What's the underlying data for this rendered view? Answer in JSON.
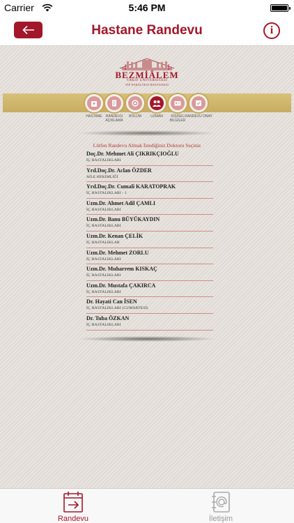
{
  "status_bar": {
    "carrier": "Carrier",
    "time": "5:46 PM"
  },
  "nav": {
    "title": "Hastane Randevu",
    "info_label": "i"
  },
  "logo": {
    "name": "BEZMİÂLEM",
    "subtitle": "VAKIF ÜNİVERSİTESİ",
    "subtitle2": "TIP FAKÜLTESİ HASTANESİ"
  },
  "steps": [
    {
      "label": "HASTANE",
      "active": false
    },
    {
      "label": "RANDEVU AÇIKLAMA",
      "active": false
    },
    {
      "label": "BÖLÜM",
      "active": false
    },
    {
      "label": "UZMAN",
      "active": true
    },
    {
      "label": "KİŞİSEL BİLGİLER",
      "active": false
    },
    {
      "label": "RANDEVU ONAY",
      "active": false
    }
  ],
  "prompt": "Lütfen Randevu Almak İstediğiniz Doktoru Seçiniz",
  "doctors": [
    {
      "name": "Doç.Dr. Mehmet Ali ÇIKRIKÇIOĞLU",
      "department": "İÇ HASTALIKLARI"
    },
    {
      "name": "Yrd.Doç.Dr. Aclan ÖZDER",
      "department": "AİLE HEKİMLİĞİ"
    },
    {
      "name": "Yrd.Doç.Dr. Cumali KARATOPRAK",
      "department": "İÇ HASTALIKLARI - 1"
    },
    {
      "name": "Uzm.Dr. Ahmet Adil ÇAMLI",
      "department": "İÇ HASTALIKLARI"
    },
    {
      "name": "Uzm.Dr. Banu BÜYÜKAYDIN",
      "department": "İÇ HASTALIKLARI"
    },
    {
      "name": "Uzm.Dr. Kenan ÇELİK",
      "department": "İÇ HASTALIKLAR"
    },
    {
      "name": "Uzm.Dr. Mehmet ZORLU",
      "department": "İÇ HASTALIKLARI"
    },
    {
      "name": "Uzm.Dr. Muharrem KISKAÇ",
      "department": "İÇ HASTALIKLARI"
    },
    {
      "name": "Uzm.Dr. Mustafa ÇAKIRCA",
      "department": "İÇ HASTALIKLARI"
    },
    {
      "name": "Dr. Hayati Can İSEN",
      "department": "İÇ HASTALIKLARI (CUMARTESİ)"
    },
    {
      "name": "Dr. Tuba ÖZKAN",
      "department": "İÇ HASTALIKLARI"
    }
  ],
  "tabs": [
    {
      "label": "Randevu",
      "icon": "calendar-arrow-icon",
      "active": true
    },
    {
      "label": "İletişim",
      "icon": "contacts-book-icon",
      "active": false
    }
  ],
  "colors": {
    "brand": "#a3172b",
    "gold": "#c8ad62",
    "divider": "#cf8e8a"
  }
}
